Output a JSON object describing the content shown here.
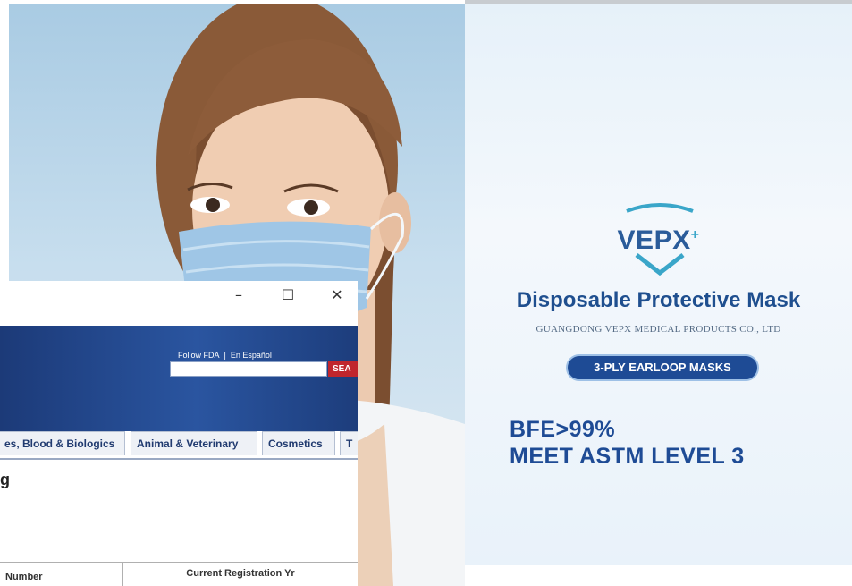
{
  "ad": {
    "brand": "VEPX",
    "brand_plus": "+",
    "title": "Disposable Protective Mask",
    "company": "GUANGDONG VEPX MEDICAL PRODUCTS CO., LTD",
    "pill": "3-PLY EARLOOP MASKS",
    "claim1": "BFE>99%",
    "claim2": "MEET ASTM LEVEL 3",
    "colors": {
      "brand_blue": "#1e4b95",
      "accent_teal": "#3aa6c9",
      "background": "#eef5fb"
    }
  },
  "window": {
    "controls": {
      "minimize": "–",
      "maximize": "☐",
      "close": "✕"
    },
    "header": {
      "follow": "Follow FDA",
      "separator": "|",
      "espanol": "En Español",
      "search_value": "",
      "search_button": "SEA"
    },
    "tabs": [
      {
        "label": "es, Blood & Biologics"
      },
      {
        "label": "Animal & Veterinary"
      },
      {
        "label": "Cosmetics"
      },
      {
        "label": "T"
      }
    ],
    "page_heading": "g",
    "table_headers": [
      "Number",
      "Current Registration Yr"
    ]
  },
  "icons": [
    "vepx-shield-icon",
    "window-minimize-icon",
    "window-maximize-icon",
    "window-close-icon"
  ]
}
